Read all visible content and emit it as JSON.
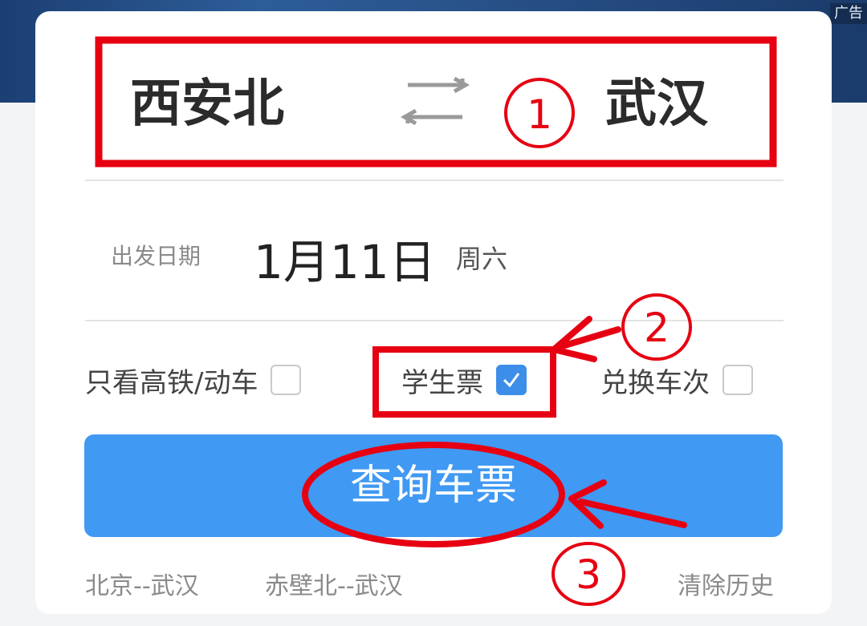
{
  "ad_label": "广告",
  "route": {
    "from": "西安北",
    "to": "武汉"
  },
  "date": {
    "label": "出发日期",
    "value": "1月11日",
    "weekday": "周六"
  },
  "options": [
    {
      "label": "只看高铁/动车",
      "checked": false
    },
    {
      "label": "学生票",
      "checked": true
    },
    {
      "label": "兑换车次",
      "checked": false
    }
  ],
  "query_button": "查询车票",
  "history": [
    "北京--武汉",
    "赤壁北--武汉"
  ],
  "clear_history": "清除历史",
  "annotations": [
    "①",
    "②",
    "③"
  ],
  "colors": {
    "primary": "#4099f2",
    "annotation": "#e60012",
    "checked": "#3d8ee8"
  }
}
